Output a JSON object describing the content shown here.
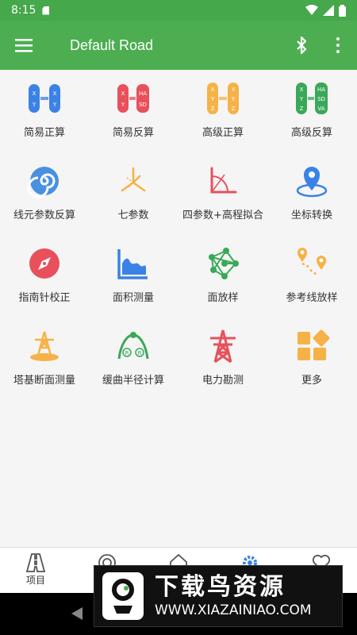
{
  "status_bar": {
    "time": "8:15"
  },
  "app_bar": {
    "title": "Default Road"
  },
  "colors": {
    "primary": "#4cae50",
    "blue": "#3b82e6",
    "red": "#e8505b",
    "orange": "#f6b246",
    "green": "#3aa859"
  },
  "grid": {
    "items": [
      {
        "label": "简易正算",
        "icon": "xy-xy-icon"
      },
      {
        "label": "简易反算",
        "icon": "xy-hasd-icon"
      },
      {
        "label": "高级正算",
        "icon": "xyz-xyz-icon"
      },
      {
        "label": "高级反算",
        "icon": "xyz-hasdva-icon"
      },
      {
        "label": "线元参数反算",
        "icon": "spiral-icon"
      },
      {
        "label": "七参数",
        "icon": "axes-3d-icon"
      },
      {
        "label": "四参数+高程拟合",
        "icon": "axes-2d-icon"
      },
      {
        "label": "坐标转换",
        "icon": "map-pin-icon"
      },
      {
        "label": "指南针校正",
        "icon": "compass-icon"
      },
      {
        "label": "面积测量",
        "icon": "area-chart-icon"
      },
      {
        "label": "面放样",
        "icon": "network-icon"
      },
      {
        "label": "参考线放样",
        "icon": "route-pins-icon"
      },
      {
        "label": "塔基断面测量",
        "icon": "tower-base-icon"
      },
      {
        "label": "缓曲半径计算",
        "icon": "curve-radius-icon"
      },
      {
        "label": "电力勘测",
        "icon": "power-tower-icon"
      },
      {
        "label": "更多",
        "icon": "more-grid-icon"
      }
    ],
    "icon_text": {
      "xy": [
        "X",
        "Y"
      ],
      "xyz": [
        "X",
        "Y",
        "Z"
      ],
      "hasd": [
        "HA",
        "SD"
      ],
      "hasdva": [
        "HA",
        "SD",
        "VA"
      ],
      "c1": "R",
      "c2": "R"
    }
  },
  "bottom_nav": {
    "items": [
      {
        "label": "项目",
        "icon": "road-icon"
      },
      {
        "label": "",
        "icon": "radar-icon"
      },
      {
        "label": "",
        "icon": "home-icon"
      },
      {
        "label": "",
        "icon": "gear-icon"
      },
      {
        "label": "",
        "icon": "heart-icon"
      }
    ]
  },
  "watermark": {
    "big": "下载鸟资源",
    "url": "WWW.XIAZAINIAO.COM"
  }
}
